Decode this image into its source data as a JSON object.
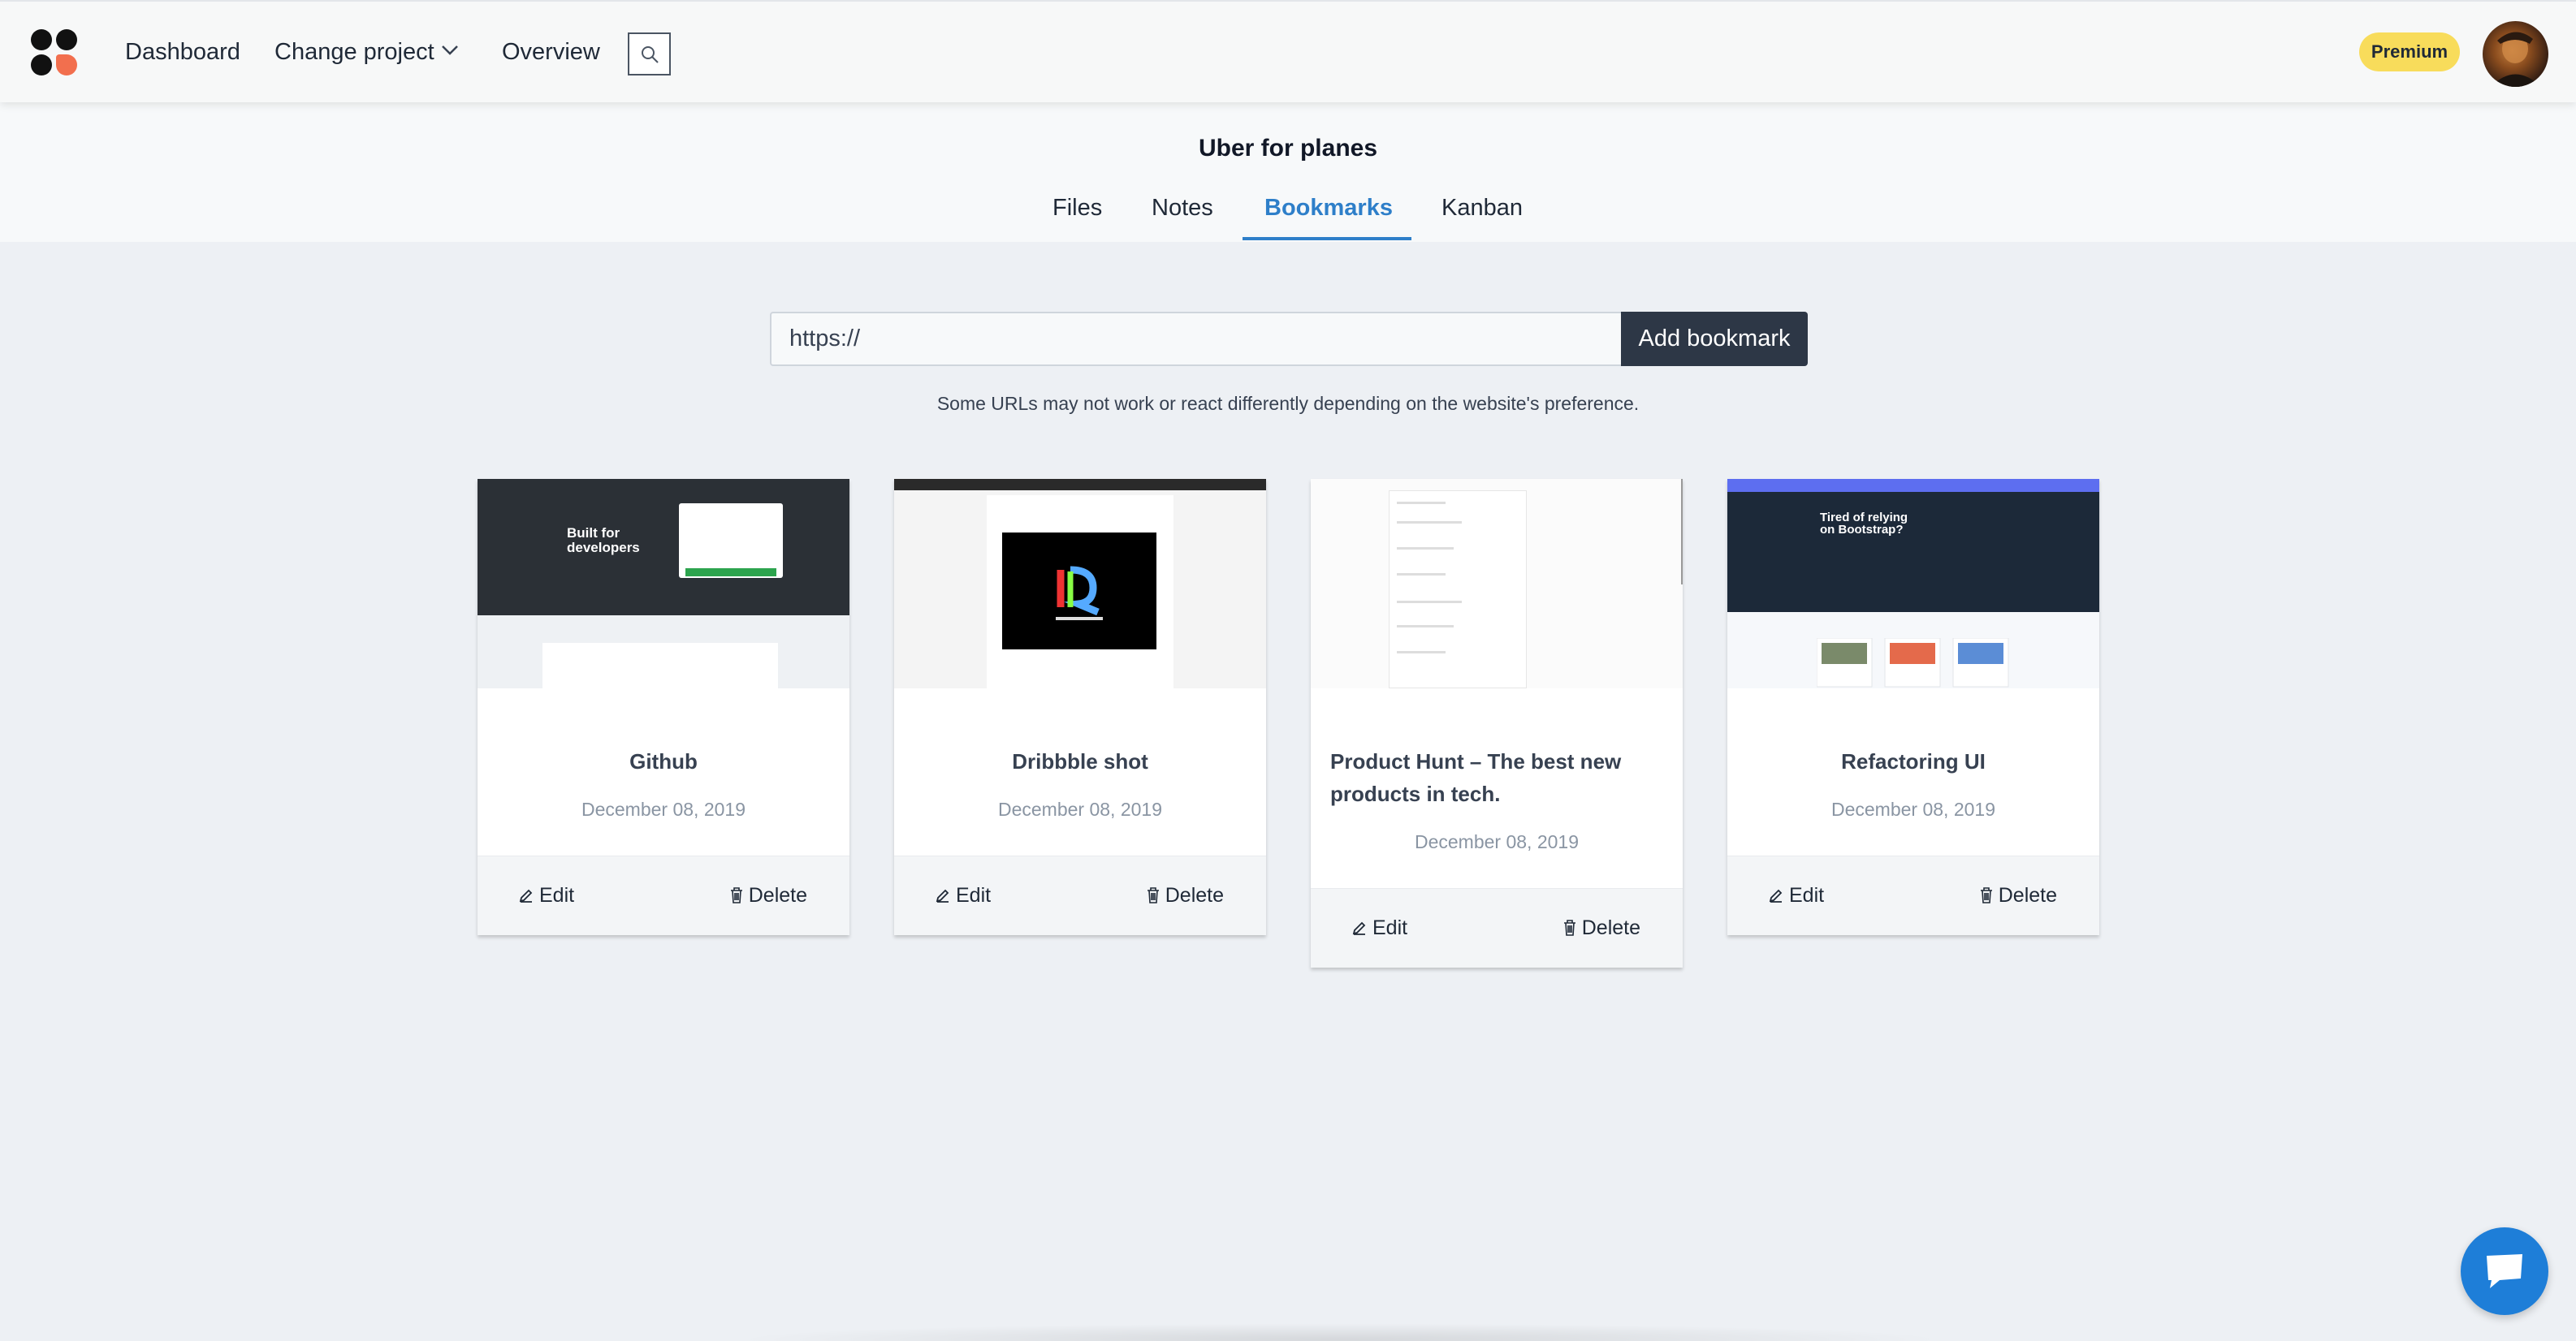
{
  "nav": {
    "dashboard": "Dashboard",
    "change_project": "Change project",
    "overview": "Overview",
    "premium_badge": "Premium"
  },
  "project": {
    "title": "Uber for planes",
    "tabs": [
      "Files",
      "Notes",
      "Bookmarks",
      "Kanban"
    ],
    "active_tab": "Bookmarks"
  },
  "bookmark_form": {
    "input_value": "https://",
    "add_button": "Add bookmark",
    "note": "Some URLs may not work or react differently depending on the website's preference."
  },
  "bookmarks": [
    {
      "title": "Github",
      "date": "December 08, 2019",
      "edit": "Edit",
      "delete": "Delete"
    },
    {
      "title": "Dribbble shot",
      "date": "December 08, 2019",
      "edit": "Edit",
      "delete": "Delete"
    },
    {
      "title": "Product Hunt – The best new products in tech.",
      "date": "December 08, 2019",
      "edit": "Edit",
      "delete": "Delete"
    },
    {
      "title": "Refactoring UI",
      "date": "December 08, 2019",
      "edit": "Edit",
      "delete": "Delete"
    }
  ],
  "thumbnails": {
    "github_headline": "Built for developers",
    "refactoring_headline": "Tired of relying on Bootstrap?"
  },
  "colors": {
    "accent": "#2e7fc9",
    "premium": "#f8dc5b",
    "button_dark": "#2d3746",
    "chat": "#1e7ed8",
    "logo_accent": "#f26f4e"
  },
  "icons": [
    "logo-icon",
    "chevron-down-icon",
    "search-icon",
    "pencil-icon",
    "trash-icon",
    "chat-icon"
  ]
}
